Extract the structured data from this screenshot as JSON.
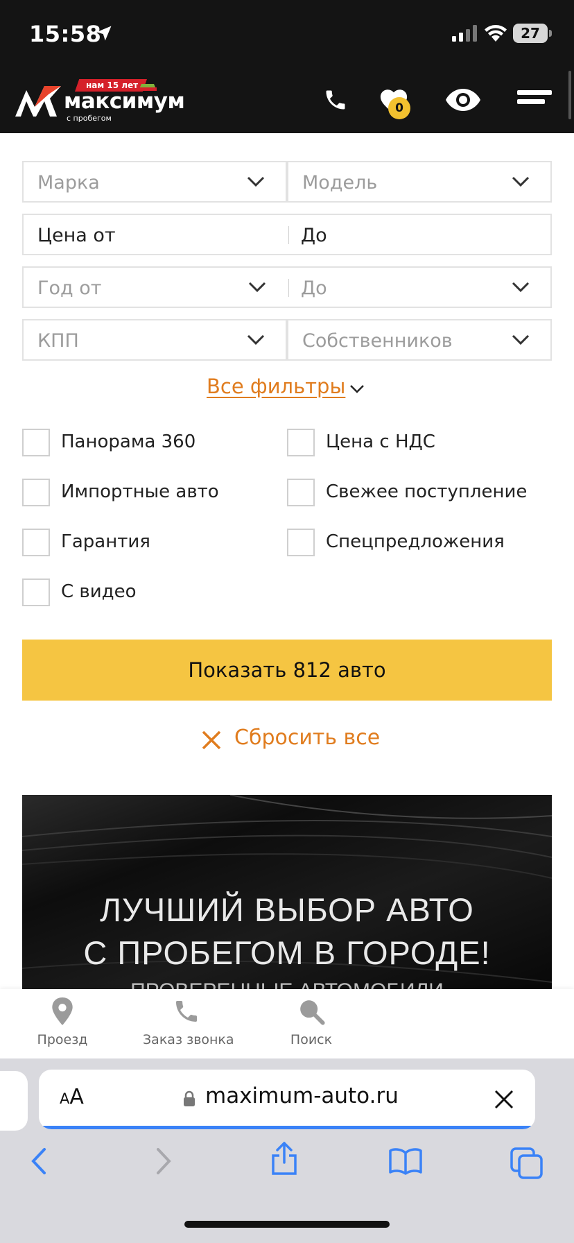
{
  "status_bar": {
    "time": "15:58",
    "battery": "27"
  },
  "header": {
    "logo": {
      "badge": "нам 15 лет",
      "name": "максимум",
      "tagline": "с пробегом"
    },
    "favorites_count": "0"
  },
  "filters": {
    "brand": {
      "placeholder": "Марка"
    },
    "model": {
      "placeholder": "Модель"
    },
    "price_from": {
      "label": "Цена от"
    },
    "price_to": {
      "label": "До"
    },
    "year_from": {
      "placeholder": "Год от"
    },
    "year_to": {
      "placeholder": "До"
    },
    "transmission": {
      "placeholder": "КПП"
    },
    "owners": {
      "placeholder": "Собственников"
    },
    "all_filters_link": "Все фильтры",
    "checkboxes": {
      "panorama": "Панорама 360",
      "vat_price": "Цена с НДС",
      "imported": "Импортные авто",
      "fresh": "Свежее поступление",
      "warranty": "Гарантия",
      "special": "Спецпредложения",
      "video": "С видео"
    },
    "show_button": "Показать 812 авто",
    "reset": "Сбросить все"
  },
  "banner": {
    "line1": "ЛУЧШИЙ ВЫБОР АВТО",
    "line2": "С ПРОБЕГОМ В ГОРОДЕ!",
    "line3": "ПРОВЕРЕННЫЕ АВТОМОБИЛИ"
  },
  "bottom_nav": {
    "directions": "Проезд",
    "callback": "Заказ звонка",
    "search": "Поиск"
  },
  "safari": {
    "text_size": "AA",
    "url": "maximum-auto.ru"
  },
  "colors": {
    "accent_orange": "#e07c1e",
    "button_yellow": "#f5c542",
    "header_bg": "#141414",
    "badge_yellow": "#f2c12f"
  }
}
